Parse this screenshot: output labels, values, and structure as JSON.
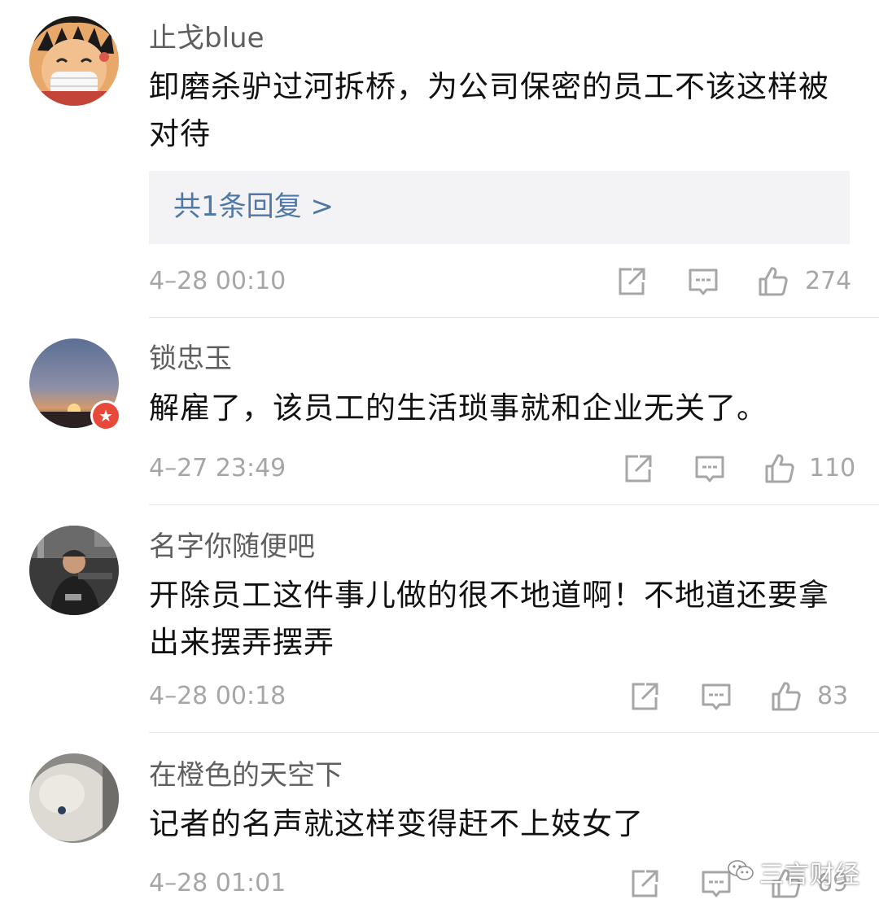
{
  "comments": [
    {
      "username": "止戈blue",
      "text": "卸磨杀驴过河拆桥，为公司保密的员工不该这样被对待",
      "reply_link": "共1条回复 >",
      "time": "4–28 00:10",
      "likes": "274",
      "avatar_icon": "cartoon-avatar"
    },
    {
      "username": "锁忠玉",
      "text": "解雇了，该员工的生活琐事就和企业无关了。",
      "time": "4–27 23:49",
      "likes": "110",
      "avatar_icon": "sunset-avatar",
      "badge_icon": "verified-badge-icon"
    },
    {
      "username": "名字你随便吧",
      "text": "开除员工这件事儿做的很不地道啊！不地道还要拿出来摆弄摆弄",
      "time": "4–28 00:18",
      "likes": "83",
      "avatar_icon": "photo-avatar"
    },
    {
      "username": "在橙色的天空下",
      "text": "记者的名声就这样变得赶不上妓女了",
      "time": "4–28 01:01",
      "likes": "69",
      "avatar_icon": "toy-avatar"
    }
  ],
  "watermark": {
    "text": "三言财经",
    "icon": "wechat-icon"
  },
  "colors": {
    "username": "#5f5f5f",
    "content": "#111111",
    "meta": "#a6a6a6",
    "reply_link": "#4f78a6",
    "reply_bg": "#f3f3f5",
    "divider": "#e3e3e3",
    "badge": "#e8493a"
  }
}
